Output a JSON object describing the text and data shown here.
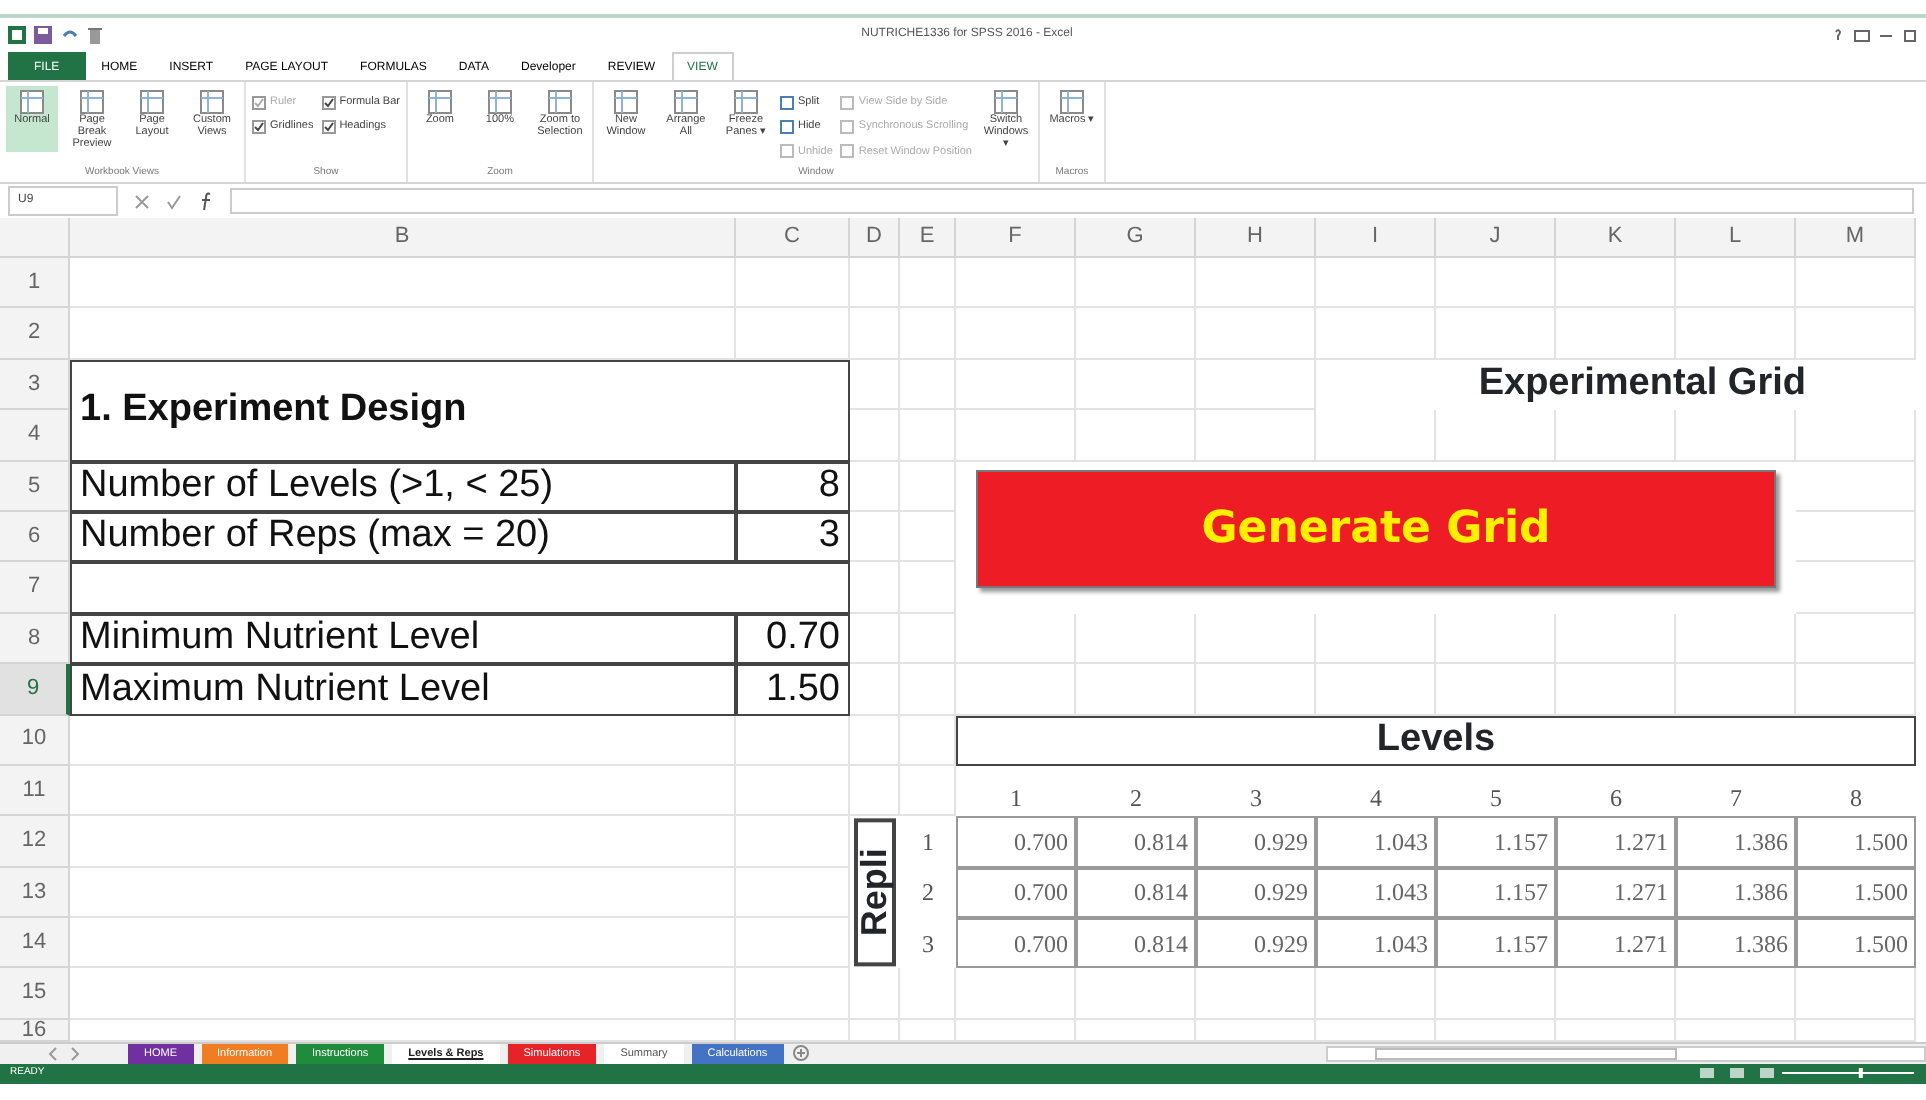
{
  "window": {
    "title": "NUTRICHE1336 for SPSS 2016 - Excel"
  },
  "ribbon_tabs": [
    {
      "label": "FILE",
      "selected": false,
      "kind": "file"
    },
    {
      "label": "HOME",
      "selected": false,
      "kind": "tab"
    },
    {
      "label": "INSERT",
      "selected": false,
      "kind": "tab"
    },
    {
      "label": "PAGE LAYOUT",
      "selected": false,
      "kind": "tab"
    },
    {
      "label": "FORMULAS",
      "selected": false,
      "kind": "tab"
    },
    {
      "label": "DATA",
      "selected": false,
      "kind": "tab"
    },
    {
      "label": "Developer",
      "selected": false,
      "kind": "tab"
    },
    {
      "label": "REVIEW",
      "selected": false,
      "kind": "tab"
    },
    {
      "label": "VIEW",
      "selected": true,
      "kind": "tab"
    }
  ],
  "ribbon_groups": [
    {
      "label": "Workbook Views",
      "items": [
        {
          "kind": "large",
          "label": "Normal",
          "selected": true
        },
        {
          "kind": "large",
          "label": "Page Break Preview",
          "selected": false
        },
        {
          "kind": "large",
          "label": "Page Layout",
          "selected": false
        },
        {
          "kind": "large",
          "label": "Custom Views",
          "selected": false
        }
      ]
    },
    {
      "label": "Show",
      "items": [
        {
          "kind": "check",
          "label": "Ruler",
          "checked": true,
          "disabled": true
        },
        {
          "kind": "check",
          "label": "Gridlines",
          "checked": true,
          "disabled": false
        },
        {
          "kind": "check",
          "label": "Formula Bar",
          "checked": true,
          "disabled": false
        },
        {
          "kind": "check",
          "label": "Headings",
          "checked": true,
          "disabled": false
        }
      ]
    },
    {
      "label": "Zoom",
      "items": [
        {
          "kind": "large",
          "label": "Zoom",
          "selected": false
        },
        {
          "kind": "large",
          "label": "100%",
          "selected": false
        },
        {
          "kind": "large",
          "label": "Zoom to Selection",
          "selected": false
        }
      ]
    },
    {
      "label": "Window",
      "items": [
        {
          "kind": "large",
          "label": "New Window",
          "selected": false
        },
        {
          "kind": "large",
          "label": "Arrange All",
          "selected": false
        },
        {
          "kind": "large",
          "label": "Freeze Panes ▾",
          "selected": false
        },
        {
          "kind": "small",
          "label": "Split",
          "disabled": false
        },
        {
          "kind": "small",
          "label": "Hide",
          "disabled": false
        },
        {
          "kind": "small",
          "label": "Unhide",
          "disabled": true
        },
        {
          "kind": "small",
          "label": "View Side by Side",
          "disabled": true
        },
        {
          "kind": "small",
          "label": "Synchronous Scrolling",
          "disabled": true
        },
        {
          "kind": "small",
          "label": "Reset Window Position",
          "disabled": true
        },
        {
          "kind": "large",
          "label": "Switch Windows ▾",
          "selected": false
        }
      ]
    },
    {
      "label": "Macros",
      "items": [
        {
          "kind": "large",
          "label": "Macros ▾",
          "selected": false
        }
      ]
    }
  ],
  "name_box": "U9",
  "columns": [
    "B",
    "C",
    "D",
    "E",
    "F",
    "G",
    "H",
    "I",
    "J",
    "K",
    "L",
    "M"
  ],
  "rows": [
    {
      "label": "1",
      "selected": false
    },
    {
      "label": "2",
      "selected": false
    },
    {
      "label": "3",
      "selected": false
    },
    {
      "label": "4",
      "selected": false
    },
    {
      "label": "5",
      "selected": false
    },
    {
      "label": "6",
      "selected": false
    },
    {
      "label": "7",
      "selected": false
    },
    {
      "label": "8",
      "selected": false
    },
    {
      "label": "9",
      "selected": true
    },
    {
      "label": "10",
      "selected": false
    },
    {
      "label": "11",
      "selected": false
    },
    {
      "label": "12",
      "selected": false
    },
    {
      "label": "13",
      "selected": false
    },
    {
      "label": "14",
      "selected": false
    },
    {
      "label": "15",
      "selected": false
    },
    {
      "label": "16",
      "selected": false
    }
  ],
  "design": {
    "title": "1. Experiment Design",
    "rows": [
      {
        "label": "Number of Levels (>1, < 25)",
        "value": "8"
      },
      {
        "label": "Number of Reps (max = 20)",
        "value": "3"
      },
      {
        "label": "Minimum Nutrient Level",
        "value": "0.70"
      },
      {
        "label": "Maximum Nutrient Level",
        "value": "1.50"
      }
    ]
  },
  "experimental_grid": {
    "title": "Experimental Grid",
    "button": "Generate Grid",
    "levels_title": "Levels",
    "level_numbers": [
      "1",
      "2",
      "3",
      "4",
      "5",
      "6",
      "7",
      "8"
    ],
    "rep_label": "Repli",
    "reps": [
      {
        "label": "1",
        "values": [
          "0.700",
          "0.814",
          "0.929",
          "1.043",
          "1.157",
          "1.271",
          "1.386",
          "1.500"
        ]
      },
      {
        "label": "2",
        "values": [
          "0.700",
          "0.814",
          "0.929",
          "1.043",
          "1.157",
          "1.271",
          "1.386",
          "1.500"
        ]
      },
      {
        "label": "3",
        "values": [
          "0.700",
          "0.814",
          "0.929",
          "1.043",
          "1.157",
          "1.271",
          "1.386",
          "1.500"
        ]
      }
    ]
  },
  "sheet_tabs": [
    {
      "label": "HOME",
      "color": "#7030a0",
      "selected": false
    },
    {
      "label": "Information",
      "color": "#f07d22",
      "selected": false
    },
    {
      "label": "Instructions",
      "color": "#1e8c3a",
      "selected": false
    },
    {
      "label": "Levels & Reps",
      "selected": true
    },
    {
      "label": "Simulations",
      "color": "#e52328",
      "selected": false
    },
    {
      "label": "Summary",
      "selected": false
    },
    {
      "label": "Calculations",
      "color": "#4472c4",
      "selected": false
    }
  ],
  "status": "READY",
  "zoom_slider": {
    "level": 0.6
  }
}
